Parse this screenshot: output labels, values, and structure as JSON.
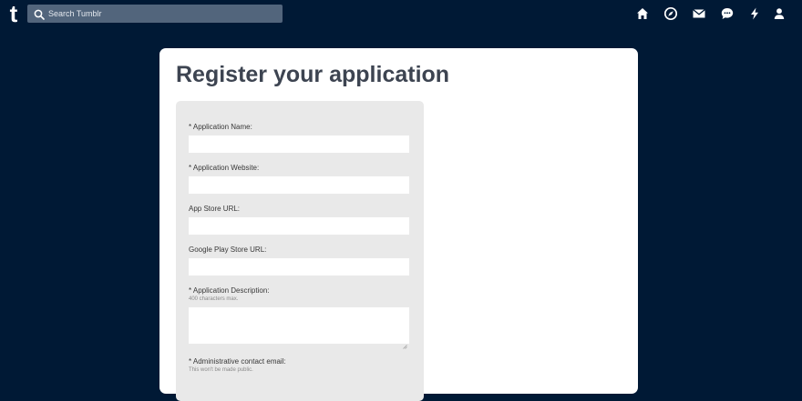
{
  "topbar": {
    "logo": "t",
    "search": {
      "placeholder": "Search Tumblr",
      "icon": "search-icon"
    },
    "nav_icons": [
      "home-icon",
      "explore-compass-icon",
      "mail-icon",
      "chat-bubble-icon",
      "activity-lightning-icon",
      "account-person-icon"
    ]
  },
  "page": {
    "title": "Register your application"
  },
  "form": {
    "fields": [
      {
        "label": "* Application Name:",
        "value": ""
      },
      {
        "label": "* Application Website:",
        "value": ""
      },
      {
        "label": "App Store URL:",
        "value": ""
      },
      {
        "label": "Google Play Store URL:",
        "value": ""
      },
      {
        "label": "* Application Description:",
        "hint": "400 characters max.",
        "value": ""
      },
      {
        "label": "* Administrative contact email:",
        "hint": "This won't be made public."
      }
    ]
  },
  "colors": {
    "background": "#001935",
    "search_bg": "#52657c",
    "panel": "#ffffff",
    "form_bg": "#e9e9e9",
    "title_text": "#3d4451"
  }
}
